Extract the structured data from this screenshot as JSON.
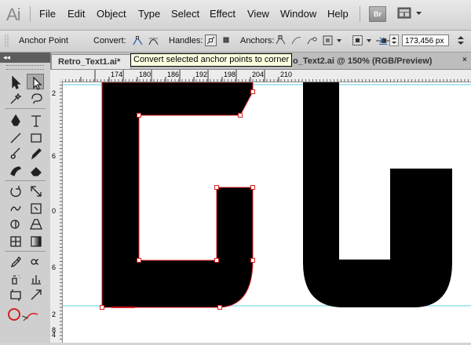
{
  "app": {
    "logo": "Ai",
    "bridge_label": "Br"
  },
  "menu": [
    "File",
    "Edit",
    "Object",
    "Type",
    "Select",
    "Effect",
    "View",
    "Window",
    "Help"
  ],
  "control_bar": {
    "tool_name": "Anchor Point",
    "convert_label": "Convert:",
    "handles_label": "Handles:",
    "anchors_label": "Anchors:",
    "x_label": "X:",
    "x_value": "173,456 px"
  },
  "tooltip": "Convert selected anchor points to corner",
  "tabs": [
    {
      "label": "Retro_Text1.ai*"
    },
    {
      "label": "o_Text2.ai @ 150% (RGB/Preview)",
      "close": "×"
    }
  ],
  "tool_panel": {
    "collapse": "◂◂"
  },
  "ruler": {
    "h_labels": [
      "174",
      "180",
      "186",
      "192",
      "198",
      "204",
      "210"
    ],
    "v_labels": [
      "2",
      "6",
      "0",
      "6",
      "2",
      "8",
      "4",
      "1",
      "2"
    ]
  },
  "colors": {
    "accent": "#3a8ee6",
    "path_outline": "#d42020",
    "guide": "#5fd0e0",
    "shape_fill": "#000000"
  },
  "icons": {
    "selection": "selection-arrow-icon",
    "direct_selection": "direct-selection-icon",
    "magic_wand": "magic-wand-icon",
    "lasso": "lasso-icon",
    "pen": "pen-icon",
    "type": "type-icon",
    "line": "line-segment-icon",
    "rectangle": "rectangle-icon",
    "brush": "paintbrush-icon",
    "pencil": "pencil-icon",
    "blob": "blob-brush-icon",
    "eraser": "eraser-icon",
    "rotate": "rotate-icon",
    "scale": "scale-icon",
    "warp": "warp-icon",
    "free_transform": "free-transform-icon",
    "shape_builder": "shape-builder-icon",
    "perspective": "perspective-grid-icon",
    "mesh": "mesh-icon",
    "gradient": "gradient-icon",
    "eyedropper": "eyedropper-icon",
    "blend": "blend-icon",
    "symbol_sprayer": "symbol-sprayer-icon",
    "graph": "column-graph-icon",
    "artboard": "artboard-icon",
    "slice": "slice-icon",
    "hand": "hand-icon",
    "zoom": "zoom-icon",
    "fill": "fill-stroke-icon",
    "swap": "swap-fill-stroke-icon"
  }
}
